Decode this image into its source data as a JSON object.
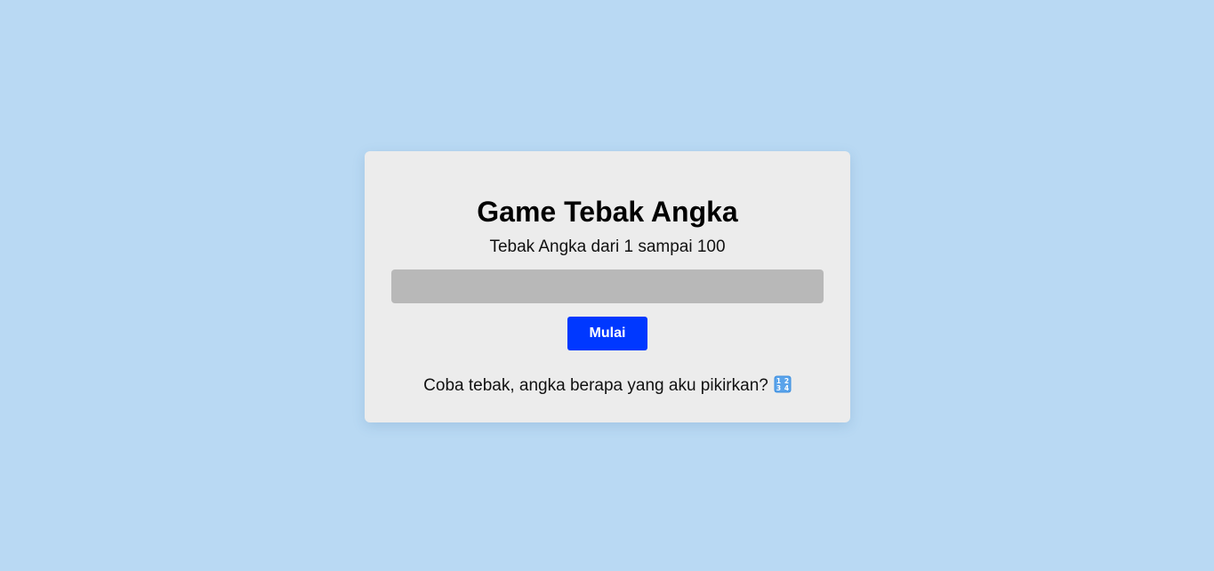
{
  "game": {
    "title": "Game Tebak Angka",
    "subtitle": "Tebak Angka dari 1 sampai 100",
    "input_value": "",
    "input_placeholder": "",
    "start_button_label": "Mulai",
    "hint_text": "Coba tebak, angka berapa yang aku pikirkan?",
    "hint_icon": "input-numbers-icon"
  },
  "colors": {
    "page_background": "#b9d9f3",
    "card_background": "#ececec",
    "input_background": "#b8b8b8",
    "button_background": "#0038ff",
    "button_text": "#ffffff"
  }
}
